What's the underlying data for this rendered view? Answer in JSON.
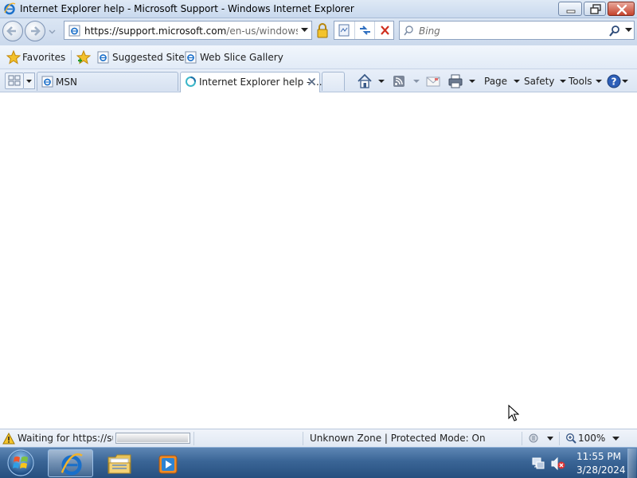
{
  "window": {
    "title": "Internet Explorer help - Microsoft Support - Windows Internet Explorer",
    "controls": {
      "minimize": "minimize-icon",
      "maximize": "restore-icon",
      "close": "close-icon"
    }
  },
  "navigation": {
    "url_host": "https://support.microsoft.com",
    "url_path": "/en-us/windows/in",
    "search_placeholder": "Bing"
  },
  "favorites_bar": {
    "favorites_label": "Favorites",
    "items": [
      {
        "label": "Suggested Sites",
        "icon": "ie-page-icon"
      },
      {
        "label": "Web Slice Gallery",
        "icon": "ie-page-icon"
      }
    ]
  },
  "tabs": [
    {
      "label": "MSN",
      "active": false
    },
    {
      "label": "Internet Explorer help - ...",
      "active": true,
      "loading": true
    }
  ],
  "command_bar": {
    "page": "Page",
    "safety": "Safety",
    "tools": "Tools"
  },
  "status_bar": {
    "text": "Waiting for https://support.microsoft.com",
    "progress": 0.97,
    "zone": "Unknown Zone | Protected Mode: On",
    "zoom": "100%"
  },
  "taskbar": {
    "pinned": [
      "internet-explorer",
      "windows-explorer",
      "windows-media-player"
    ],
    "time": "11:55 PM",
    "date": "3/28/2024"
  },
  "colors": {
    "chrome": "#dbe6f4",
    "taskbar": "#3a6596",
    "close_button": "#c5432c"
  }
}
